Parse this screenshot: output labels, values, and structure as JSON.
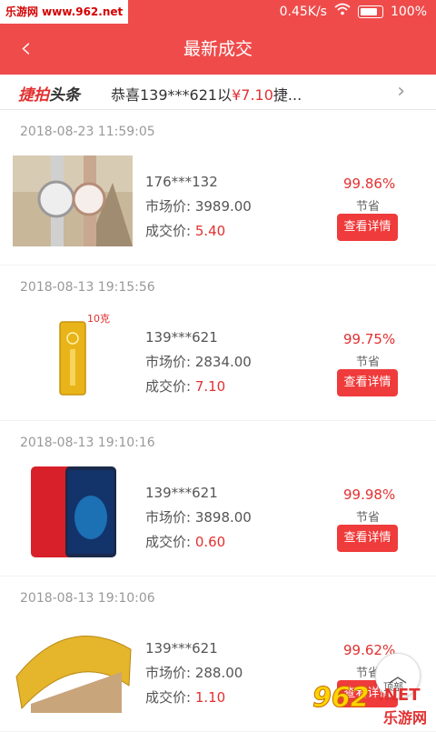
{
  "status": {
    "watermark": "乐游网 www.962.net",
    "speed": "0.45K/s",
    "battery": "100%"
  },
  "header": {
    "title": "最新成交",
    "back": "‹"
  },
  "ticker": {
    "brand_a": "捷拍",
    "brand_b": "头条",
    "msg_prefix": "恭喜139***621以",
    "msg_price": "¥7.10",
    "msg_suffix": "捷..."
  },
  "items": [
    {
      "date": "2018-08-23 11:59:05",
      "user": "176***132",
      "market": "市场价: 3989.00",
      "deal_label": "成交价: ",
      "deal": "5.40",
      "pct": "99.86%",
      "save": "节省",
      "btn": "查看详情"
    },
    {
      "date": "2018-08-13 19:15:56",
      "user": "139***621",
      "market": "市场价: 2834.00",
      "deal_label": "成交价: ",
      "deal": "7.10",
      "pct": "99.75%",
      "save": "节省",
      "btn": "查看详情",
      "tag": "10克"
    },
    {
      "date": "2018-08-13 19:10:16",
      "user": "139***621",
      "market": "市场价: 3898.00",
      "deal_label": "成交价: ",
      "deal": "0.60",
      "pct": "99.98%",
      "save": "节省",
      "btn": "查看详情"
    },
    {
      "date": "2018-08-13 19:10:06",
      "user": "139***621",
      "market": "市场价: 288.00",
      "deal_label": "成交价: ",
      "deal": "1.10",
      "pct": "99.62%",
      "save": "节省",
      "btn": "查看详情"
    }
  ],
  "top": {
    "label": "顶部"
  },
  "watermark2": {
    "a": "962",
    "b": ".NET",
    "c": "乐游网"
  }
}
